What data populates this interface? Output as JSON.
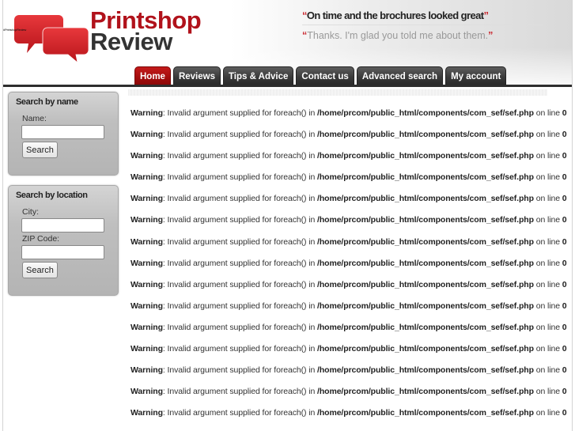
{
  "header": {
    "logo_alt": "#PrintshopReview",
    "logo_line1": "Printshop",
    "logo_line2": "Review",
    "quote_open": "“",
    "quote_close": "”",
    "testimonial": "On time and the brochures looked great",
    "reply": "Thanks. I'm glad you told me about them.",
    "brand_color": "#b1121b"
  },
  "nav": {
    "tabs": [
      {
        "label": "Home",
        "active": true
      },
      {
        "label": "Reviews"
      },
      {
        "label": "Tips & Advice"
      },
      {
        "label": "Contact us"
      },
      {
        "label": "Advanced search"
      },
      {
        "label": "My account"
      }
    ]
  },
  "sidebar": {
    "search_by_name": {
      "title": "Search by name",
      "name_label": "Name:",
      "name_value": "",
      "button": "Search"
    },
    "search_by_location": {
      "title": "Search by location",
      "city_label": "City:",
      "city_value": "",
      "zip_label": "ZIP Code:",
      "zip_value": "",
      "button": "Search"
    }
  },
  "warnings": {
    "label": "Warning",
    "message": ": Invalid argument supplied for foreach() in ",
    "path": "/home/prcom/public_html/components/com_sef/sef.php",
    "line_text": " on line ",
    "line": "0",
    "count": 15
  }
}
